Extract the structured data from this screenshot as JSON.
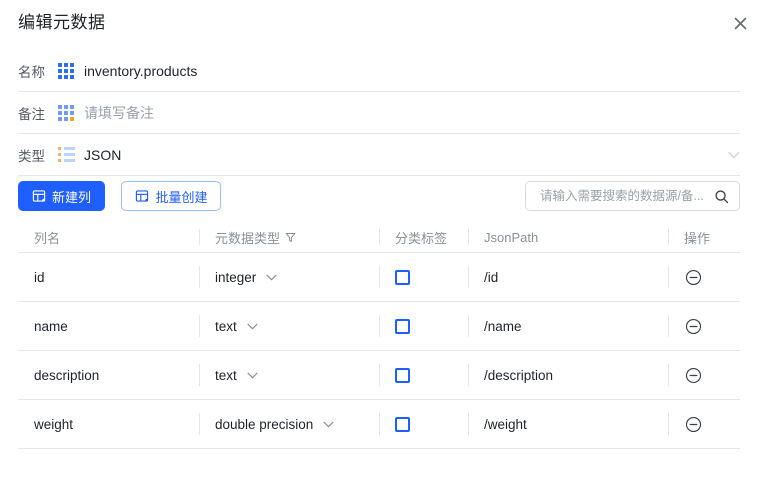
{
  "dialog": {
    "title": "编辑元数据",
    "close_icon": "close-icon"
  },
  "form": {
    "name": {
      "label": "名称",
      "icon": "grid-icon",
      "value": "inventory.products"
    },
    "remark": {
      "label": "备注",
      "icon": "grid-icon-orange",
      "placeholder": "请填写备注"
    },
    "type": {
      "label": "类型",
      "icon": "list-icon",
      "value": "JSON",
      "chevron": "chevron-down-icon"
    }
  },
  "toolbar": {
    "new_column_label": "新建列",
    "new_column_icon": "table-column-icon",
    "batch_create_label": "批量创建",
    "batch_create_icon": "table-column-icon",
    "search_placeholder": "请输入需要搜索的数据源/备...",
    "search_value": "",
    "search_icon": "search-icon"
  },
  "table": {
    "headers": {
      "column_name": "列名",
      "metadata_type": "元数据类型",
      "metadata_type_filter_icon": "filter-icon",
      "category_tag": "分类标签",
      "json_path": "JsonPath",
      "operation": "操作"
    },
    "rows": [
      {
        "column_name": "id",
        "metadata_type": "integer",
        "category_tag_checked": false,
        "json_path": "/id",
        "remove_icon": "minus-circle-icon"
      },
      {
        "column_name": "name",
        "metadata_type": "text",
        "category_tag_checked": false,
        "json_path": "/name",
        "remove_icon": "minus-circle-icon"
      },
      {
        "column_name": "description",
        "metadata_type": "text",
        "category_tag_checked": false,
        "json_path": "/description",
        "remove_icon": "minus-circle-icon"
      },
      {
        "column_name": "weight",
        "metadata_type": "double precision",
        "category_tag_checked": false,
        "json_path": "/weight",
        "remove_icon": "minus-circle-icon"
      }
    ]
  },
  "colors": {
    "primary": "#1f5eff",
    "border": "#e4e6eb",
    "text": "#1f2329",
    "muted": "#8a9099",
    "accent_orange": "#f5a623"
  }
}
